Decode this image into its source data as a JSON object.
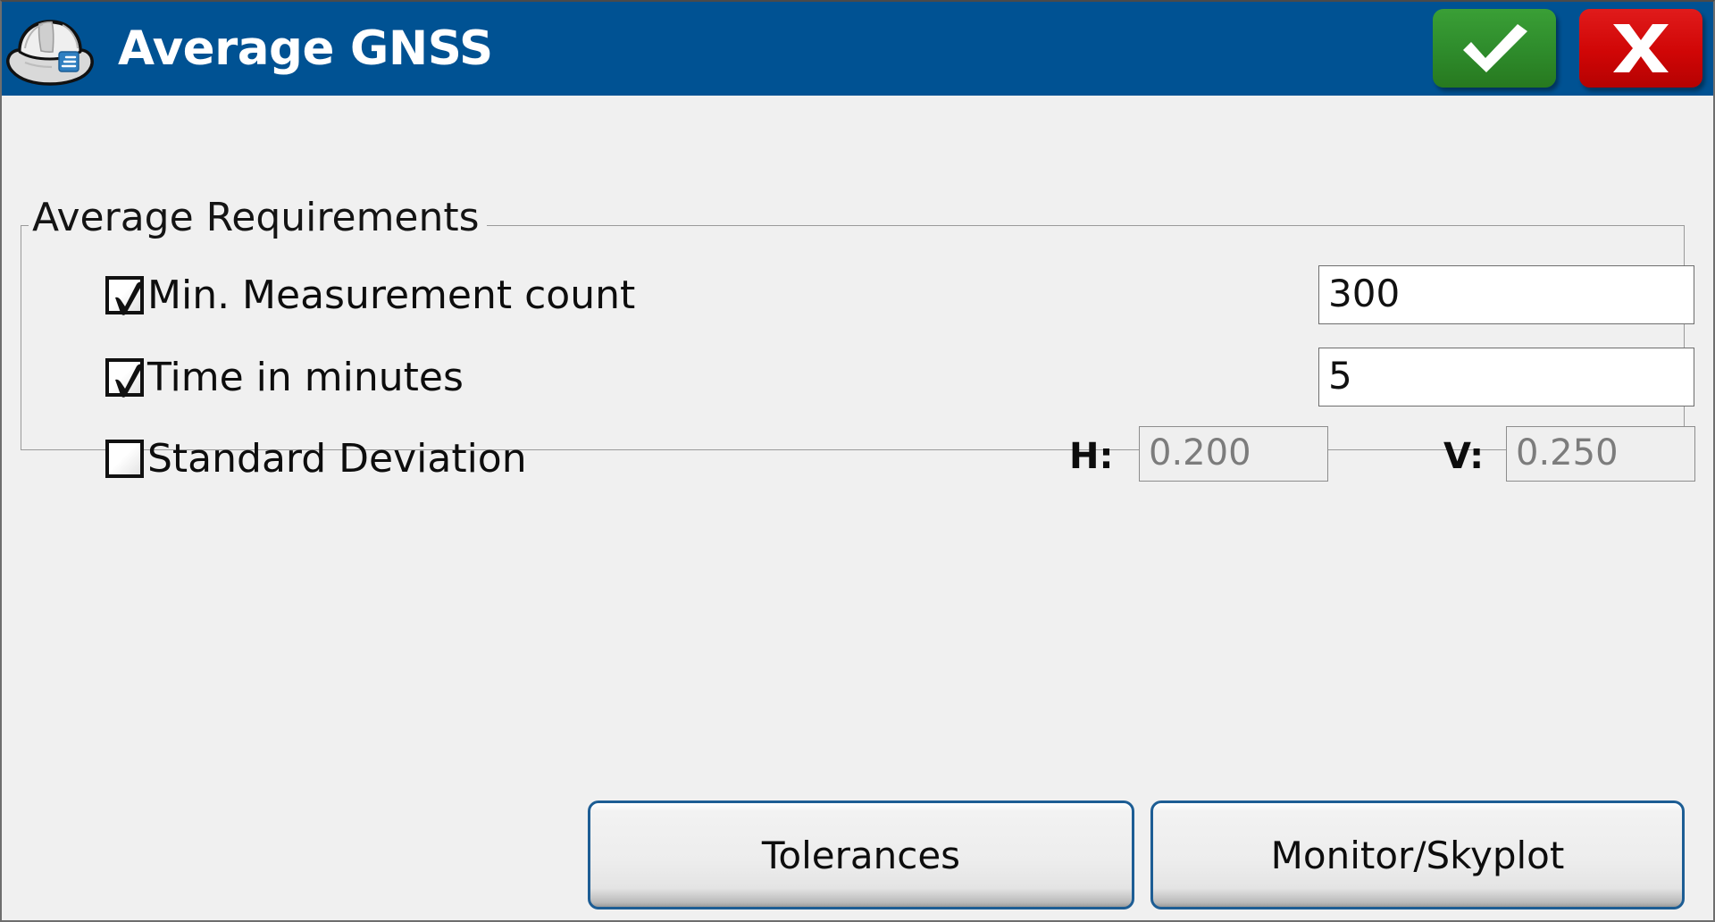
{
  "titlebar": {
    "title": "Average GNSS",
    "icon": "hard-hat-icon",
    "accept_icon": "checkmark-icon",
    "cancel_icon": "close-x-icon",
    "background_color": "#005293",
    "accept_color": "#2e8b2b",
    "cancel_color": "#d00606"
  },
  "group": {
    "legend": "Average Requirements",
    "rows": [
      {
        "label": "Min. Measurement count",
        "checked": true,
        "value": "300",
        "placeholder": ""
      },
      {
        "label": "Time in minutes",
        "checked": true,
        "value": "5",
        "placeholder": ""
      },
      {
        "label": "Standard Deviation",
        "checked": false,
        "h_label": "H:",
        "h_value": "0.200",
        "v_label": "V:",
        "v_value": "0.250"
      }
    ]
  },
  "footer": {
    "tolerances_label": "Tolerances",
    "monitor_label": "Monitor/Skyplot"
  }
}
